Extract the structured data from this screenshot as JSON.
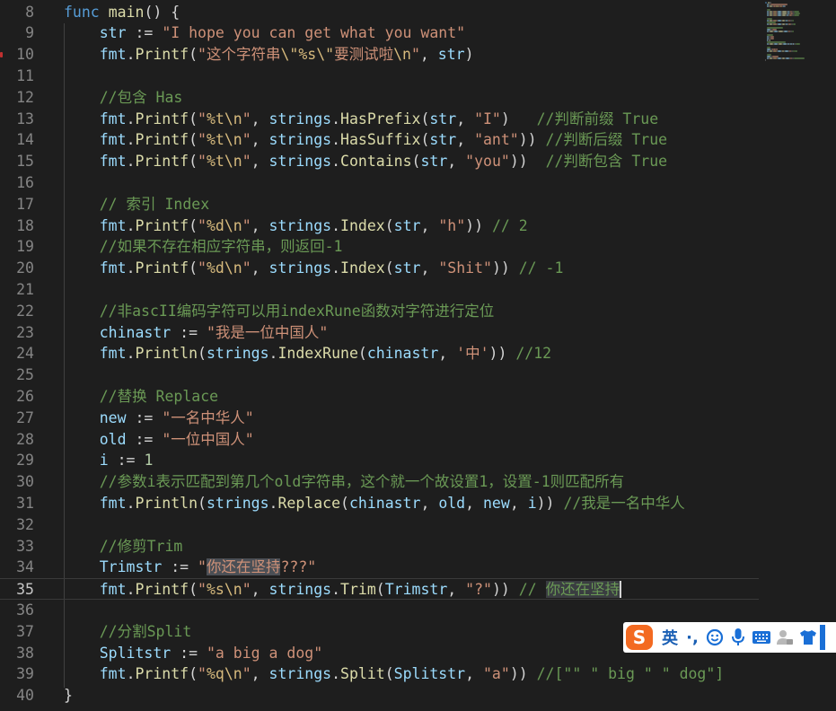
{
  "editor": {
    "lines": [
      {
        "n": "8",
        "tokens": [
          {
            "c": "k",
            "t": "func"
          },
          {
            "c": "o",
            "t": " "
          },
          {
            "c": "f",
            "t": "main"
          },
          {
            "c": "o",
            "t": "() {"
          }
        ]
      },
      {
        "n": "9",
        "tokens": [
          {
            "c": "o",
            "t": "    "
          },
          {
            "c": "v",
            "t": "str"
          },
          {
            "c": "o",
            "t": " := "
          },
          {
            "c": "s",
            "t": "\"I hope you can get what you want\""
          }
        ]
      },
      {
        "n": "10",
        "tokens": [
          {
            "c": "o",
            "t": "    "
          },
          {
            "c": "v",
            "t": "fmt"
          },
          {
            "c": "o",
            "t": "."
          },
          {
            "c": "f",
            "t": "Printf"
          },
          {
            "c": "o",
            "t": "("
          },
          {
            "c": "s",
            "t": "\"这个字符串"
          },
          {
            "c": "e",
            "t": "\\\""
          },
          {
            "c": "e",
            "t": "%s"
          },
          {
            "c": "e",
            "t": "\\\""
          },
          {
            "c": "s",
            "t": "要测试啦"
          },
          {
            "c": "e",
            "t": "\\n"
          },
          {
            "c": "s",
            "t": "\""
          },
          {
            "c": "o",
            "t": ", "
          },
          {
            "c": "v",
            "t": "str"
          },
          {
            "c": "o",
            "t": ")"
          }
        ]
      },
      {
        "n": "11",
        "tokens": []
      },
      {
        "n": "12",
        "tokens": [
          {
            "c": "o",
            "t": "    "
          },
          {
            "c": "c",
            "t": "//包含 Has"
          }
        ]
      },
      {
        "n": "13",
        "tokens": [
          {
            "c": "o",
            "t": "    "
          },
          {
            "c": "v",
            "t": "fmt"
          },
          {
            "c": "o",
            "t": "."
          },
          {
            "c": "f",
            "t": "Printf"
          },
          {
            "c": "o",
            "t": "("
          },
          {
            "c": "s",
            "t": "\""
          },
          {
            "c": "e",
            "t": "%t"
          },
          {
            "c": "e",
            "t": "\\n"
          },
          {
            "c": "s",
            "t": "\""
          },
          {
            "c": "o",
            "t": ", "
          },
          {
            "c": "v",
            "t": "strings"
          },
          {
            "c": "o",
            "t": "."
          },
          {
            "c": "f",
            "t": "HasPrefix"
          },
          {
            "c": "o",
            "t": "("
          },
          {
            "c": "v",
            "t": "str"
          },
          {
            "c": "o",
            "t": ", "
          },
          {
            "c": "s",
            "t": "\"I\""
          },
          {
            "c": "o",
            "t": ")   "
          },
          {
            "c": "c",
            "t": "//判断前缀 True"
          }
        ]
      },
      {
        "n": "14",
        "tokens": [
          {
            "c": "o",
            "t": "    "
          },
          {
            "c": "v",
            "t": "fmt"
          },
          {
            "c": "o",
            "t": "."
          },
          {
            "c": "f",
            "t": "Printf"
          },
          {
            "c": "o",
            "t": "("
          },
          {
            "c": "s",
            "t": "\""
          },
          {
            "c": "e",
            "t": "%t"
          },
          {
            "c": "e",
            "t": "\\n"
          },
          {
            "c": "s",
            "t": "\""
          },
          {
            "c": "o",
            "t": ", "
          },
          {
            "c": "v",
            "t": "strings"
          },
          {
            "c": "o",
            "t": "."
          },
          {
            "c": "f",
            "t": "HasSuffix"
          },
          {
            "c": "o",
            "t": "("
          },
          {
            "c": "v",
            "t": "str"
          },
          {
            "c": "o",
            "t": ", "
          },
          {
            "c": "s",
            "t": "\"ant\""
          },
          {
            "c": "o",
            "t": ")) "
          },
          {
            "c": "c",
            "t": "//判断后缀 True"
          }
        ]
      },
      {
        "n": "15",
        "tokens": [
          {
            "c": "o",
            "t": "    "
          },
          {
            "c": "v",
            "t": "fmt"
          },
          {
            "c": "o",
            "t": "."
          },
          {
            "c": "f",
            "t": "Printf"
          },
          {
            "c": "o",
            "t": "("
          },
          {
            "c": "s",
            "t": "\""
          },
          {
            "c": "e",
            "t": "%t"
          },
          {
            "c": "e",
            "t": "\\n"
          },
          {
            "c": "s",
            "t": "\""
          },
          {
            "c": "o",
            "t": ", "
          },
          {
            "c": "v",
            "t": "strings"
          },
          {
            "c": "o",
            "t": "."
          },
          {
            "c": "f",
            "t": "Contains"
          },
          {
            "c": "o",
            "t": "("
          },
          {
            "c": "v",
            "t": "str"
          },
          {
            "c": "o",
            "t": ", "
          },
          {
            "c": "s",
            "t": "\"you\""
          },
          {
            "c": "o",
            "t": "))  "
          },
          {
            "c": "c",
            "t": "//判断包含 True"
          }
        ]
      },
      {
        "n": "16",
        "tokens": []
      },
      {
        "n": "17",
        "tokens": [
          {
            "c": "o",
            "t": "    "
          },
          {
            "c": "c",
            "t": "// 索引 Index"
          }
        ]
      },
      {
        "n": "18",
        "tokens": [
          {
            "c": "o",
            "t": "    "
          },
          {
            "c": "v",
            "t": "fmt"
          },
          {
            "c": "o",
            "t": "."
          },
          {
            "c": "f",
            "t": "Printf"
          },
          {
            "c": "o",
            "t": "("
          },
          {
            "c": "s",
            "t": "\""
          },
          {
            "c": "e",
            "t": "%d"
          },
          {
            "c": "e",
            "t": "\\n"
          },
          {
            "c": "s",
            "t": "\""
          },
          {
            "c": "o",
            "t": ", "
          },
          {
            "c": "v",
            "t": "strings"
          },
          {
            "c": "o",
            "t": "."
          },
          {
            "c": "f",
            "t": "Index"
          },
          {
            "c": "o",
            "t": "("
          },
          {
            "c": "v",
            "t": "str"
          },
          {
            "c": "o",
            "t": ", "
          },
          {
            "c": "s",
            "t": "\"h\""
          },
          {
            "c": "o",
            "t": ")) "
          },
          {
            "c": "c",
            "t": "// 2"
          }
        ]
      },
      {
        "n": "19",
        "tokens": [
          {
            "c": "o",
            "t": "    "
          },
          {
            "c": "c",
            "t": "//如果不存在相应字符串，则返回-1"
          }
        ]
      },
      {
        "n": "20",
        "tokens": [
          {
            "c": "o",
            "t": "    "
          },
          {
            "c": "v",
            "t": "fmt"
          },
          {
            "c": "o",
            "t": "."
          },
          {
            "c": "f",
            "t": "Printf"
          },
          {
            "c": "o",
            "t": "("
          },
          {
            "c": "s",
            "t": "\""
          },
          {
            "c": "e",
            "t": "%d"
          },
          {
            "c": "e",
            "t": "\\n"
          },
          {
            "c": "s",
            "t": "\""
          },
          {
            "c": "o",
            "t": ", "
          },
          {
            "c": "v",
            "t": "strings"
          },
          {
            "c": "o",
            "t": "."
          },
          {
            "c": "f",
            "t": "Index"
          },
          {
            "c": "o",
            "t": "("
          },
          {
            "c": "v",
            "t": "str"
          },
          {
            "c": "o",
            "t": ", "
          },
          {
            "c": "s",
            "t": "\"Shit\""
          },
          {
            "c": "o",
            "t": ")) "
          },
          {
            "c": "c",
            "t": "// -1"
          }
        ]
      },
      {
        "n": "21",
        "tokens": []
      },
      {
        "n": "22",
        "tokens": [
          {
            "c": "o",
            "t": "    "
          },
          {
            "c": "c",
            "t": "//非ascII编码字符可以用indexRune函数对字符进行定位"
          }
        ]
      },
      {
        "n": "23",
        "tokens": [
          {
            "c": "o",
            "t": "    "
          },
          {
            "c": "v",
            "t": "chinastr"
          },
          {
            "c": "o",
            "t": " := "
          },
          {
            "c": "s",
            "t": "\"我是一位中国人\""
          }
        ]
      },
      {
        "n": "24",
        "tokens": [
          {
            "c": "o",
            "t": "    "
          },
          {
            "c": "v",
            "t": "fmt"
          },
          {
            "c": "o",
            "t": "."
          },
          {
            "c": "f",
            "t": "Println"
          },
          {
            "c": "o",
            "t": "("
          },
          {
            "c": "v",
            "t": "strings"
          },
          {
            "c": "o",
            "t": "."
          },
          {
            "c": "f",
            "t": "IndexRune"
          },
          {
            "c": "o",
            "t": "("
          },
          {
            "c": "v",
            "t": "chinastr"
          },
          {
            "c": "o",
            "t": ", "
          },
          {
            "c": "s",
            "t": "'中'"
          },
          {
            "c": "o",
            "t": ")) "
          },
          {
            "c": "c",
            "t": "//12"
          }
        ]
      },
      {
        "n": "25",
        "tokens": []
      },
      {
        "n": "26",
        "tokens": [
          {
            "c": "o",
            "t": "    "
          },
          {
            "c": "c",
            "t": "//替换 Replace"
          }
        ]
      },
      {
        "n": "27",
        "tokens": [
          {
            "c": "o",
            "t": "    "
          },
          {
            "c": "v",
            "t": "new"
          },
          {
            "c": "o",
            "t": " := "
          },
          {
            "c": "s",
            "t": "\"一名中华人\""
          }
        ]
      },
      {
        "n": "28",
        "tokens": [
          {
            "c": "o",
            "t": "    "
          },
          {
            "c": "v",
            "t": "old"
          },
          {
            "c": "o",
            "t": " := "
          },
          {
            "c": "s",
            "t": "\"一位中国人\""
          }
        ]
      },
      {
        "n": "29",
        "tokens": [
          {
            "c": "o",
            "t": "    "
          },
          {
            "c": "v",
            "t": "i"
          },
          {
            "c": "o",
            "t": " := "
          },
          {
            "c": "n",
            "t": "1"
          }
        ]
      },
      {
        "n": "30",
        "tokens": [
          {
            "c": "o",
            "t": "    "
          },
          {
            "c": "c",
            "t": "//参数i表示匹配到第几个old字符串，这个就一个故设置1，设置-1则匹配所有"
          }
        ]
      },
      {
        "n": "31",
        "tokens": [
          {
            "c": "o",
            "t": "    "
          },
          {
            "c": "v",
            "t": "fmt"
          },
          {
            "c": "o",
            "t": "."
          },
          {
            "c": "f",
            "t": "Println"
          },
          {
            "c": "o",
            "t": "("
          },
          {
            "c": "v",
            "t": "strings"
          },
          {
            "c": "o",
            "t": "."
          },
          {
            "c": "f",
            "t": "Replace"
          },
          {
            "c": "o",
            "t": "("
          },
          {
            "c": "v",
            "t": "chinastr"
          },
          {
            "c": "o",
            "t": ", "
          },
          {
            "c": "v",
            "t": "old"
          },
          {
            "c": "o",
            "t": ", "
          },
          {
            "c": "v",
            "t": "new"
          },
          {
            "c": "o",
            "t": ", "
          },
          {
            "c": "v",
            "t": "i"
          },
          {
            "c": "o",
            "t": ")) "
          },
          {
            "c": "c",
            "t": "//我是一名中华人"
          }
        ]
      },
      {
        "n": "32",
        "tokens": []
      },
      {
        "n": "33",
        "tokens": [
          {
            "c": "o",
            "t": "    "
          },
          {
            "c": "c",
            "t": "//修剪Trim"
          }
        ]
      },
      {
        "n": "34",
        "tokens": [
          {
            "c": "o",
            "t": "    "
          },
          {
            "c": "v",
            "t": "Trimstr"
          },
          {
            "c": "o",
            "t": " := "
          },
          {
            "c": "s",
            "t": "\""
          },
          {
            "c": "s hl",
            "t": "你还在坚持"
          },
          {
            "c": "s",
            "t": "???\""
          }
        ]
      },
      {
        "n": "35",
        "tokens": [
          {
            "c": "o",
            "t": "    "
          },
          {
            "c": "v",
            "t": "fmt"
          },
          {
            "c": "o",
            "t": "."
          },
          {
            "c": "f",
            "t": "Printf"
          },
          {
            "c": "o",
            "t": "("
          },
          {
            "c": "s",
            "t": "\""
          },
          {
            "c": "e",
            "t": "%s"
          },
          {
            "c": "e",
            "t": "\\n"
          },
          {
            "c": "s",
            "t": "\""
          },
          {
            "c": "o",
            "t": ", "
          },
          {
            "c": "v",
            "t": "strings"
          },
          {
            "c": "o",
            "t": "."
          },
          {
            "c": "f",
            "t": "Trim"
          },
          {
            "c": "o",
            "t": "("
          },
          {
            "c": "v",
            "t": "Trimstr"
          },
          {
            "c": "o",
            "t": ", "
          },
          {
            "c": "s",
            "t": "\"?\""
          },
          {
            "c": "o",
            "t": ")) "
          },
          {
            "c": "c",
            "t": "// "
          },
          {
            "c": "c hl2",
            "t": "你还在坚持"
          }
        ],
        "current": true
      },
      {
        "n": "36",
        "tokens": []
      },
      {
        "n": "37",
        "tokens": [
          {
            "c": "o",
            "t": "    "
          },
          {
            "c": "c",
            "t": "//分割Split"
          }
        ]
      },
      {
        "n": "38",
        "tokens": [
          {
            "c": "o",
            "t": "    "
          },
          {
            "c": "v",
            "t": "Splitstr"
          },
          {
            "c": "o",
            "t": " := "
          },
          {
            "c": "s",
            "t": "\"a big a dog\""
          }
        ]
      },
      {
        "n": "39",
        "tokens": [
          {
            "c": "o",
            "t": "    "
          },
          {
            "c": "v",
            "t": "fmt"
          },
          {
            "c": "o",
            "t": "."
          },
          {
            "c": "f",
            "t": "Printf"
          },
          {
            "c": "o",
            "t": "("
          },
          {
            "c": "s",
            "t": "\""
          },
          {
            "c": "e",
            "t": "%q"
          },
          {
            "c": "e",
            "t": "\\n"
          },
          {
            "c": "s",
            "t": "\""
          },
          {
            "c": "o",
            "t": ", "
          },
          {
            "c": "v",
            "t": "strings"
          },
          {
            "c": "o",
            "t": "."
          },
          {
            "c": "f",
            "t": "Split"
          },
          {
            "c": "o",
            "t": "("
          },
          {
            "c": "v",
            "t": "Splitstr"
          },
          {
            "c": "o",
            "t": ", "
          },
          {
            "c": "s",
            "t": "\"a\""
          },
          {
            "c": "o",
            "t": ")) "
          },
          {
            "c": "c",
            "t": "//[\"\" \" big \" \" dog\"]"
          }
        ]
      },
      {
        "n": "40",
        "tokens": [
          {
            "c": "o",
            "t": "}"
          }
        ]
      }
    ]
  },
  "ime_toolbar": {
    "logo": "S",
    "language": "英",
    "punctuation": "·,",
    "icons": [
      "emoji-icon",
      "microphone-icon",
      "keyboard-icon",
      "user-icon",
      "skin-icon"
    ]
  }
}
